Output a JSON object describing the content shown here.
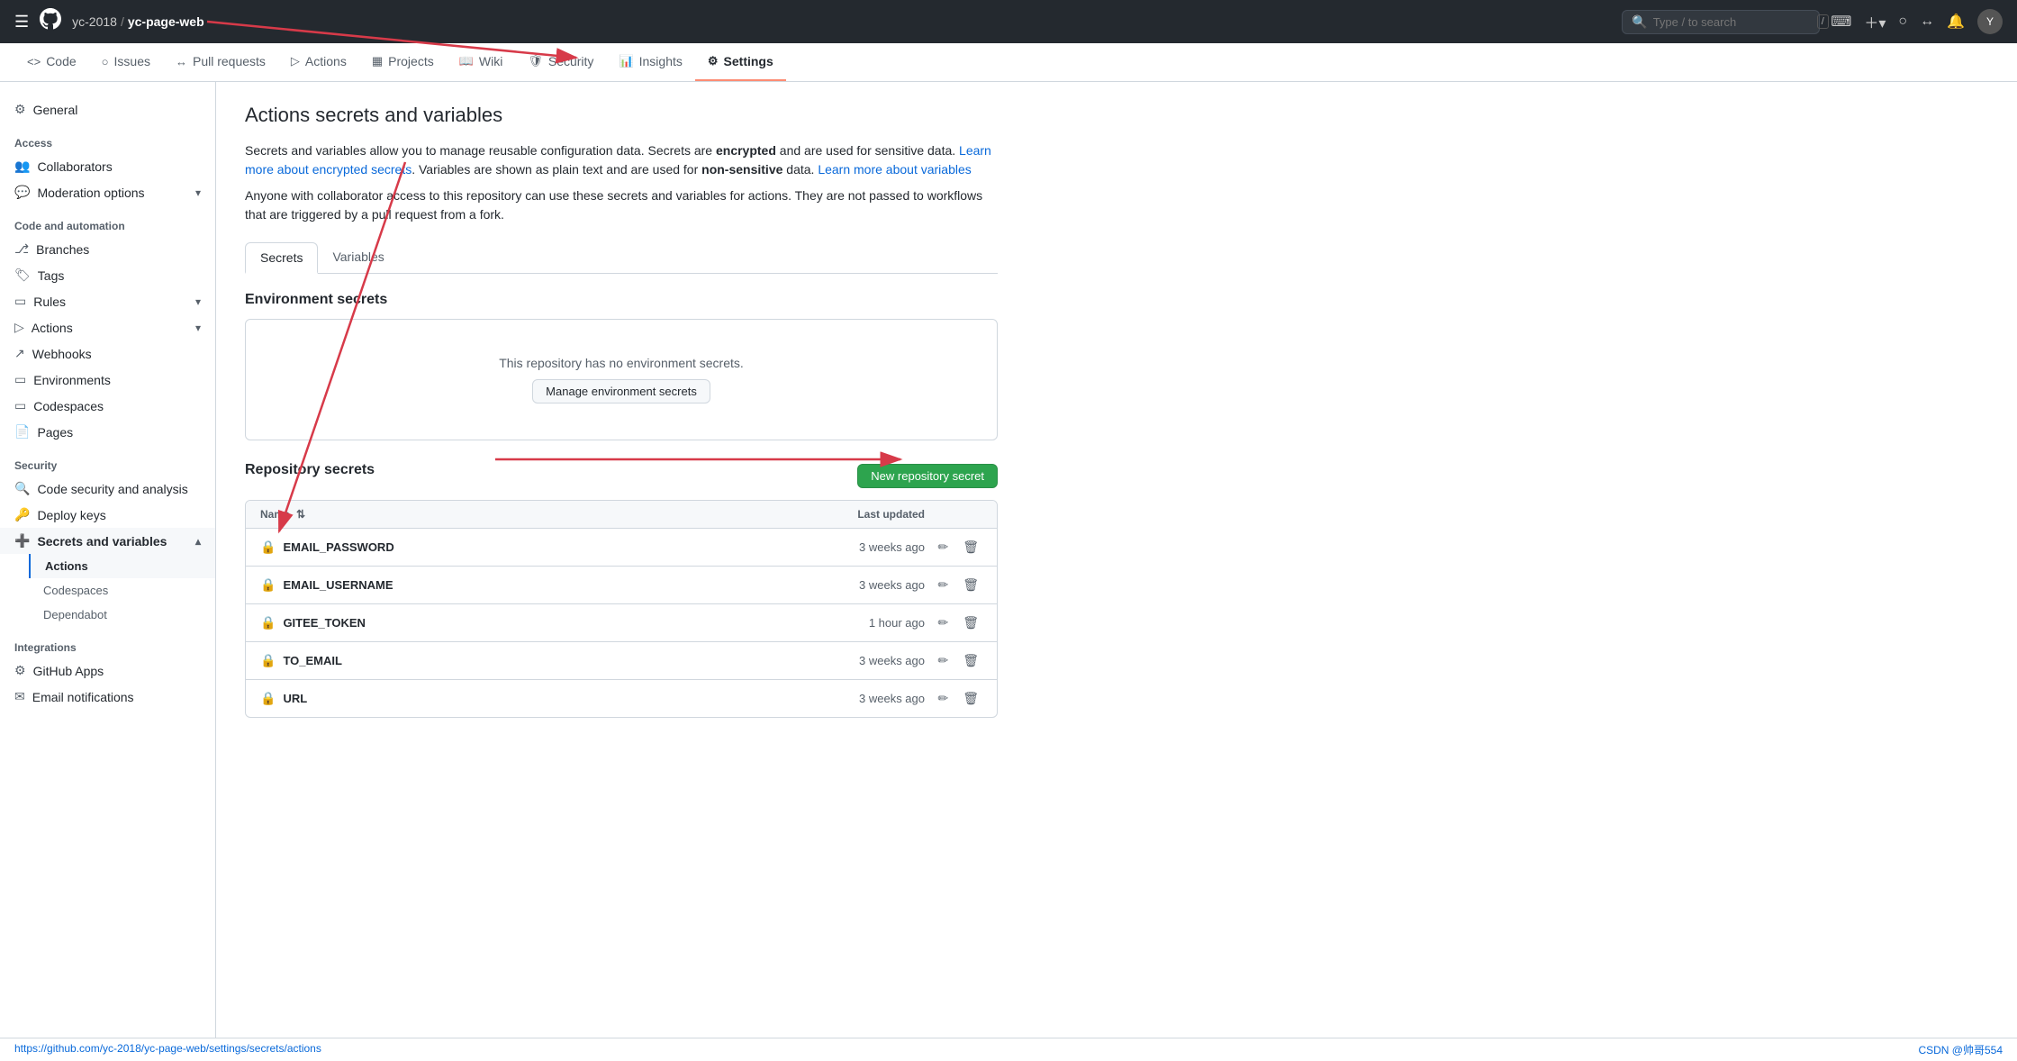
{
  "topnav": {
    "org": "yc-2018",
    "repo": "yc-page-web",
    "search_placeholder": "Type / to search"
  },
  "tabs": [
    {
      "id": "code",
      "label": "Code",
      "icon": "⌨"
    },
    {
      "id": "issues",
      "label": "Issues",
      "icon": "○"
    },
    {
      "id": "pull-requests",
      "label": "Pull requests",
      "icon": "↔"
    },
    {
      "id": "actions",
      "label": "Actions",
      "icon": "▷"
    },
    {
      "id": "projects",
      "label": "Projects",
      "icon": "▦"
    },
    {
      "id": "wiki",
      "label": "Wiki",
      "icon": "📖"
    },
    {
      "id": "security",
      "label": "Security",
      "icon": "🛡"
    },
    {
      "id": "insights",
      "label": "Insights",
      "icon": "📊"
    },
    {
      "id": "settings",
      "label": "Settings",
      "icon": "⚙"
    }
  ],
  "sidebar": {
    "general_label": "General",
    "access_label": "Access",
    "collaborators_label": "Collaborators",
    "moderation_label": "Moderation options",
    "code_automation_label": "Code and automation",
    "branches_label": "Branches",
    "tags_label": "Tags",
    "rules_label": "Rules",
    "actions_label": "Actions",
    "webhooks_label": "Webhooks",
    "environments_label": "Environments",
    "codespaces_label": "Codespaces",
    "pages_label": "Pages",
    "security_label": "Security",
    "code_security_label": "Code security and analysis",
    "deploy_keys_label": "Deploy keys",
    "secrets_variables_label": "Secrets and variables",
    "sub_actions_label": "Actions",
    "sub_codespaces_label": "Codespaces",
    "sub_dependabot_label": "Dependabot",
    "integrations_label": "Integrations",
    "github_apps_label": "GitHub Apps",
    "email_notifications_label": "Email notifications"
  },
  "content": {
    "page_title": "Actions secrets and variables",
    "description_1": "Secrets and variables allow you to manage reusable configuration data. Secrets are ",
    "description_bold_1": "encrypted",
    "description_2": " and are used for sensitive data. ",
    "description_link_1": "Learn more about encrypted secrets",
    "description_3": ". Variables are shown as plain text and are used for ",
    "description_bold_2": "non-sensitive",
    "description_4": " data. ",
    "description_link_2": "Learn more about variables",
    "collab_note": "Anyone with collaborator access to this repository can use these secrets and variables for actions. They are not passed to workflows that are triggered by a pull request from a fork.",
    "tab_secrets": "Secrets",
    "tab_variables": "Variables",
    "env_secrets_title": "Environment secrets",
    "env_empty_msg": "This repository has no environment secrets.",
    "manage_env_btn": "Manage environment secrets",
    "repo_secrets_title": "Repository secrets",
    "new_secret_btn": "New repository secret",
    "table_col_name": "Name",
    "table_col_updated": "Last updated",
    "secrets": [
      {
        "name": "EMAIL_PASSWORD",
        "updated": "3 weeks ago"
      },
      {
        "name": "EMAIL_USERNAME",
        "updated": "3 weeks ago"
      },
      {
        "name": "GITEE_TOKEN",
        "updated": "1 hour ago"
      },
      {
        "name": "TO_EMAIL",
        "updated": "3 weeks ago"
      },
      {
        "name": "URL",
        "updated": "3 weeks ago"
      }
    ]
  },
  "status_bar": {
    "url": "https://github.com/yc-2018/yc-page-web/settings/secrets/actions",
    "right": "CSDN @帅哥554"
  }
}
